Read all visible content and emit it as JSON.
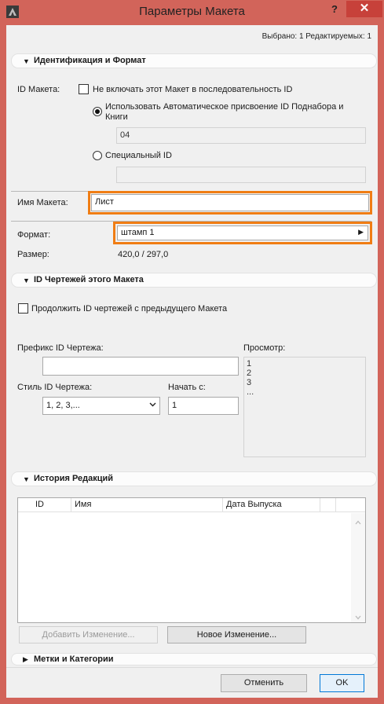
{
  "window": {
    "title": "Параметры Макета",
    "help": "?",
    "close": "✕"
  },
  "status": "Выбрано: 1 Редактируемых: 1",
  "sec_id": {
    "title": "Идентификация и Формат",
    "layout_id_label": "ID Макета:",
    "exclude_label": "Не включать этот Макет в последовательность ID",
    "auto_label": "Использовать Автоматическое присвоение ID Поднабора и Книги",
    "auto_value": "04",
    "custom_label": "Специальный ID",
    "custom_value": "",
    "name_label": "Имя Макета:",
    "name_value": "Лист",
    "format_label": "Формат:",
    "format_value": "штамп 1",
    "size_label": "Размер:",
    "size_value": "420,0 / 297,0"
  },
  "sec_draw": {
    "title": "ID Чертежей этого Макета",
    "continue_label": "Продолжить ID чертежей с предыдущего Макета",
    "prefix_label": "Префикс ID Чертежа:",
    "prefix_value": "",
    "style_label": "Стиль ID Чертежа:",
    "style_value": "1, 2, 3,...",
    "start_label": "Начать с:",
    "start_value": "1",
    "preview_label": "Просмотр:",
    "preview_lines": [
      "1",
      "2",
      "3",
      "..."
    ]
  },
  "sec_hist": {
    "title": "История Редакций",
    "columns": [
      "ID",
      "Имя",
      "Дата Выпуска"
    ],
    "add_btn": "Добавить Изменение...",
    "new_btn": "Новое Изменение..."
  },
  "sec_tags": {
    "title": "Метки и Категории"
  },
  "buttons": {
    "cancel": "Отменить",
    "ok": "OK"
  },
  "colors": {
    "frame": "#d2645a",
    "close": "#c7413a",
    "highlight": "#f07d14"
  }
}
